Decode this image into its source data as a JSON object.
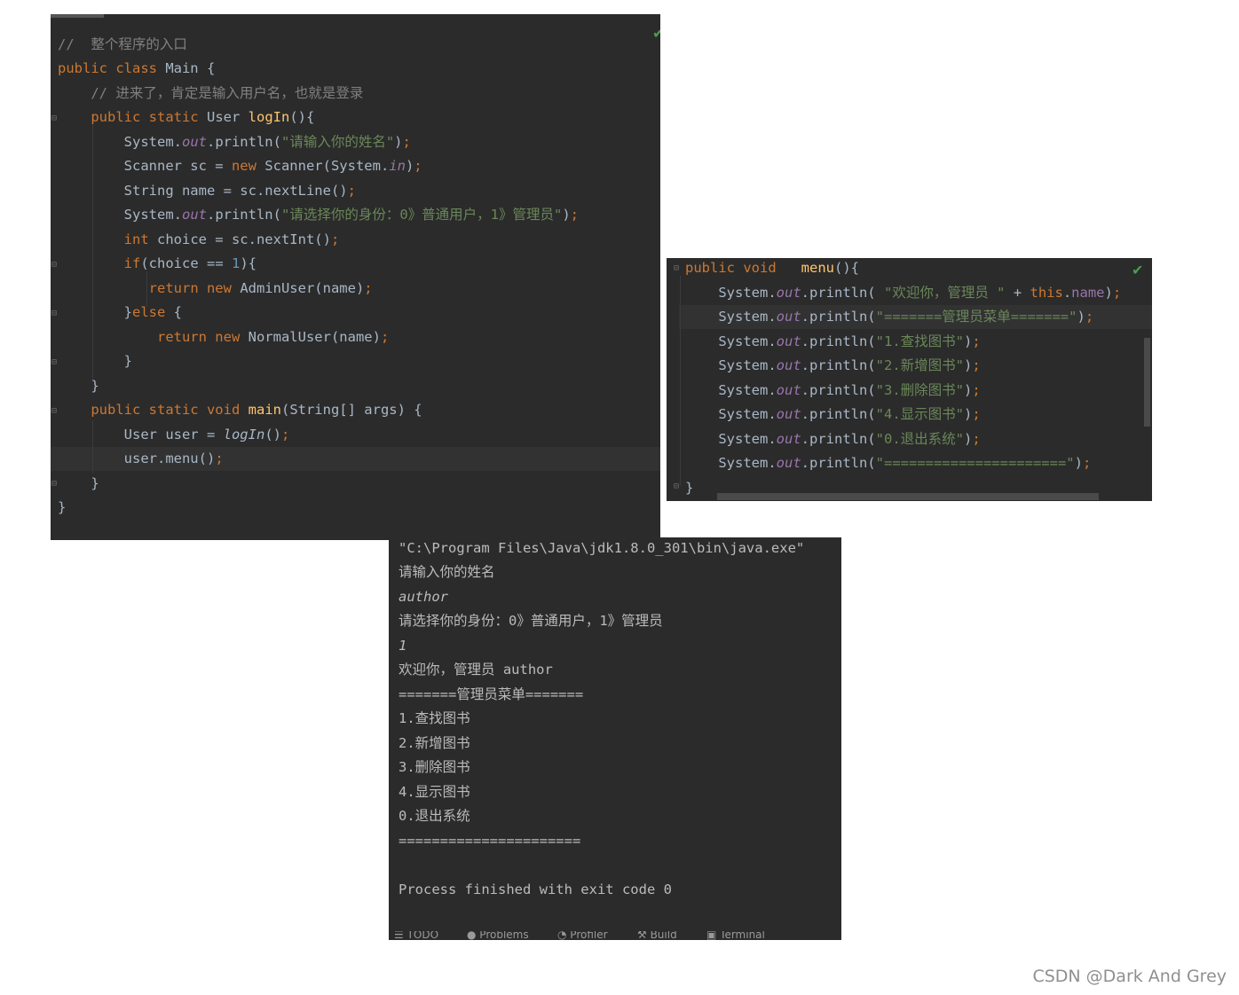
{
  "editor_main": {
    "lines": [
      "//  整个程序的入口",
      "public class Main {",
      "    // 进来了，肯定是输入用户名，也就是登录",
      "    public static User logIn(){",
      "        System.out.println(\"请输入你的姓名\");",
      "        Scanner sc = new Scanner(System.in);",
      "        String name = sc.nextLine();",
      "        System.out.println(\"请选择你的身份：0》普通用户，1》管理员\");",
      "        int choice = sc.nextInt();",
      "        if(choice == 1){",
      "           return new AdminUser(name);",
      "        }else {",
      "            return new NormalUser(name);",
      "        }",
      "    }",
      "    public static void main(String[] args) {",
      "        User user = logIn();",
      "        user.menu();",
      "    }",
      "}"
    ]
  },
  "editor_menu": {
    "lines": [
      "public void   menu(){",
      "    System.out.println( \"欢迎你，管理员 \" + this.name);",
      "    System.out.println(\"=======管理员菜单=======\");",
      "    System.out.println(\"1.查找图书\");",
      "    System.out.println(\"2.新增图书\");",
      "    System.out.println(\"3.删除图书\");",
      "    System.out.println(\"4.显示图书\");",
      "    System.out.println(\"0.退出系统\");",
      "    System.out.println(\"======================\");",
      "}"
    ]
  },
  "console": {
    "lines": [
      "\"C:\\Program Files\\Java\\jdk1.8.0_301\\bin\\java.exe\"",
      "请输入你的姓名",
      "author",
      "请选择你的身份：0》普通用户，1》管理员",
      "1",
      "欢迎你，管理员 author",
      "=======管理员菜单=======",
      "1.查找图书",
      "2.新增图书",
      "3.删除图书",
      "4.显示图书",
      "0.退出系统",
      "======================",
      "",
      "Process finished with exit code 0"
    ],
    "tabs": [
      "TODO",
      "Problems",
      "Profiler",
      "Build",
      "Terminal"
    ]
  },
  "watermark": "CSDN @Dark And Grey",
  "colors": {
    "editor_bg": "#2b2b2b",
    "keyword": "#cc7832",
    "string": "#6a8759",
    "comment": "#808080",
    "field": "#9876aa",
    "method": "#ffc66d",
    "number": "#6897bb",
    "user_input": "#2d8a2d"
  }
}
